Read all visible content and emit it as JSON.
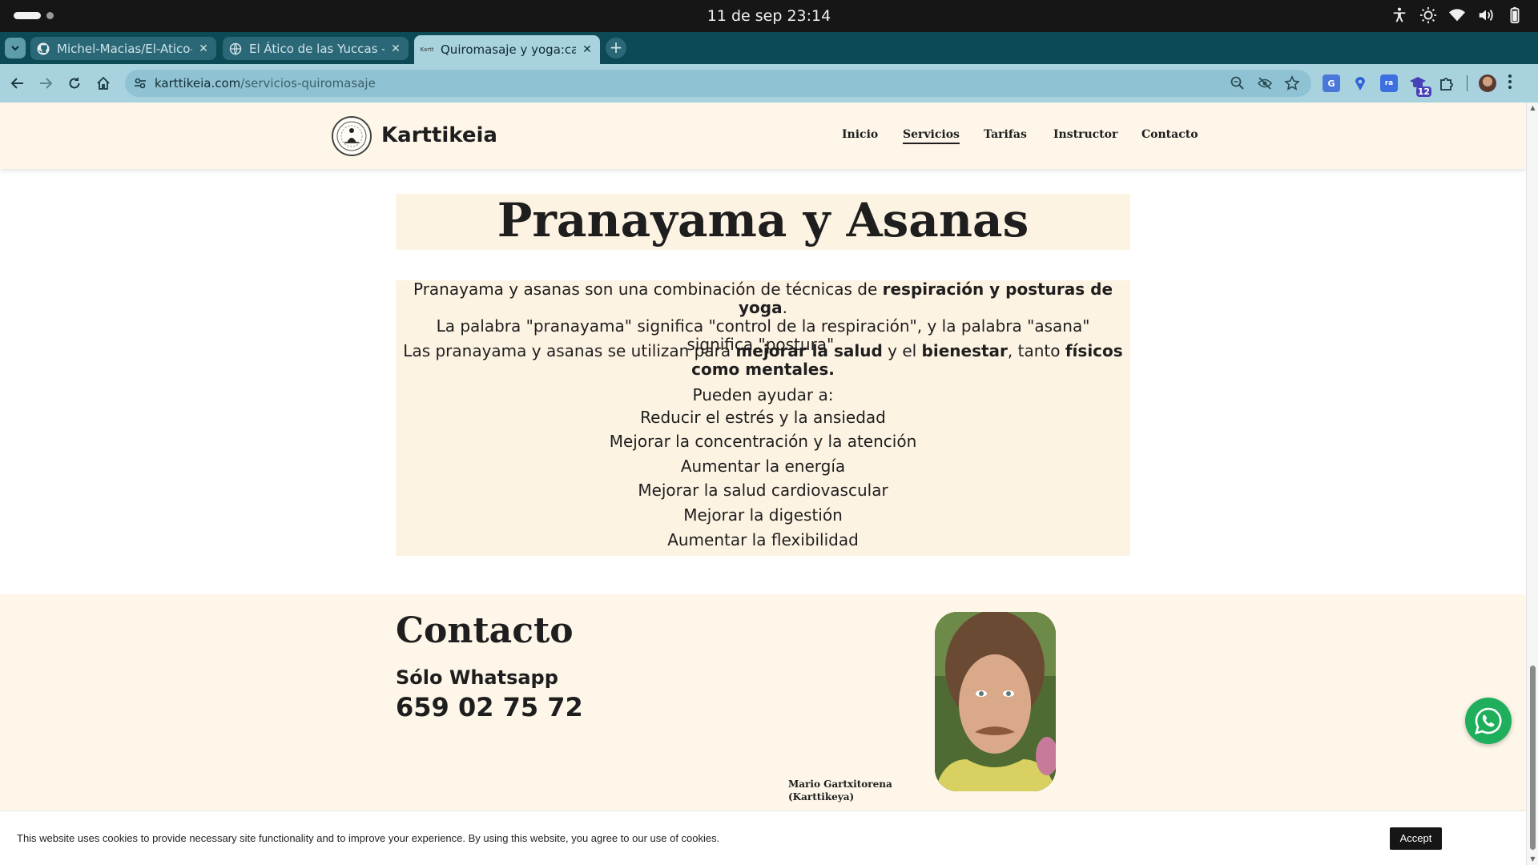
{
  "os": {
    "clock": "11 de sep  23:14",
    "tray_icons": [
      "accessibility-icon",
      "brightness-icon",
      "wifi-icon",
      "volume-icon",
      "battery-icon"
    ]
  },
  "browser": {
    "tabs": [
      {
        "title": "Michel-Macias/El-Atico-",
        "favicon": "github-icon",
        "active": false
      },
      {
        "title": "El Ático de las Yuccas - Y",
        "favicon": "globe-icon",
        "active": false
      },
      {
        "title": "Quiromasaje y yoga:car",
        "favicon": "site-favicon",
        "active": true
      }
    ],
    "favicon_text": "Kartt",
    "url_host": "karttikeia.com",
    "url_path": "/servicios-quiromasaje",
    "extension_badge": "12"
  },
  "site": {
    "brand": "Karttikeia",
    "nav": [
      {
        "label": "Inicio",
        "active": false
      },
      {
        "label": "Servicios",
        "active": true
      },
      {
        "label": "Tarifas",
        "active": false
      },
      {
        "label": "Instructor",
        "active": false
      },
      {
        "label": "Contacto",
        "active": false
      }
    ]
  },
  "section": {
    "title": "Pranayama y Asanas",
    "p1_a": "Pranayama y asanas son una combinación de técnicas de ",
    "p1_b": "respiración y posturas de yoga",
    "p1_c": ".",
    "p1_d": "La palabra \"pranayama\" significa \"control de la respiración\", y la palabra \"asana\" significa \"postura\".",
    "p2_a": "Las pranayama y asanas se utilizan para ",
    "p2_b": "mejorar la salud",
    "p2_c": " y el ",
    "p2_d": "bienestar",
    "p2_e": ", tanto ",
    "p2_f": "físicos como mentales.",
    "intro": "Pueden ayudar a:",
    "benefits": [
      "Reducir el estrés y la ansiedad",
      "Mejorar la concentración y la atención",
      "Aumentar la energía",
      "Mejorar la salud cardiovascular",
      "Mejorar la digestión",
      "Aumentar la flexibilidad"
    ]
  },
  "contact": {
    "title": "Contacto",
    "subtitle": "Sólo Whatsapp",
    "phone": "659 02 75 72",
    "instructor_line1": "Mario Gartxitorena",
    "instructor_line2": "(Karttikeya)"
  },
  "cookie": {
    "text": "This website uses cookies to provide necessary site functionality and to improve your experience. By using this website, you agree to our use of cookies.",
    "accept": "Accept"
  },
  "colors": {
    "tab_strip": "#0d4a56",
    "toolbar": "#a9d2df",
    "cream": "#fdf3e3",
    "whatsapp": "#1fae5c"
  }
}
